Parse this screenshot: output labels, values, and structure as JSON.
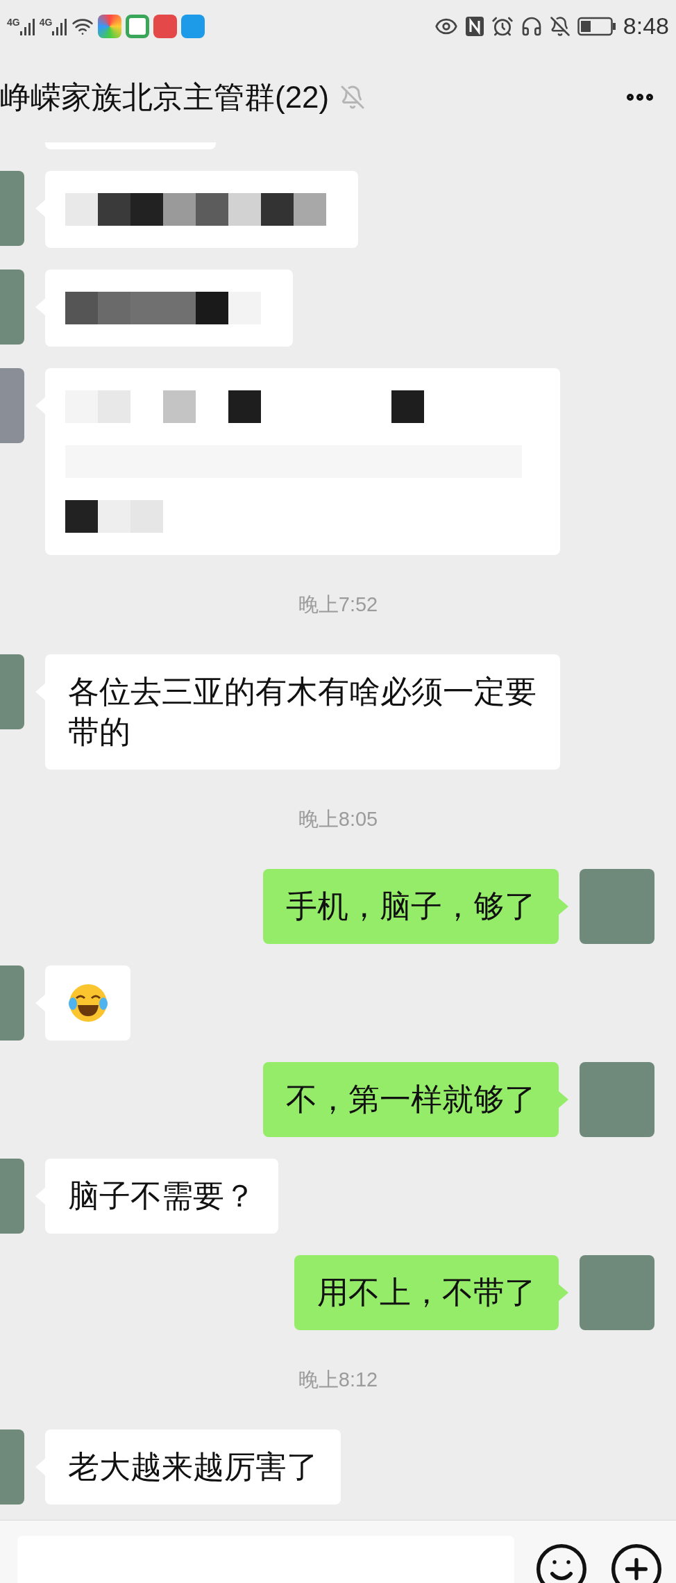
{
  "status_bar": {
    "networks": [
      "4G",
      "4G"
    ],
    "time": "8:48"
  },
  "header": {
    "title": "峥嵘家族北京主管群(22)",
    "muted": true
  },
  "messages": [
    {
      "kind": "cut",
      "outgoing": false
    },
    {
      "kind": "redacted",
      "outgoing": false
    },
    {
      "kind": "redacted",
      "outgoing": false
    },
    {
      "kind": "redacted",
      "outgoing": false
    },
    {
      "kind": "time",
      "text": "晚上7:52"
    },
    {
      "kind": "text",
      "outgoing": false,
      "text": "各位去三亚的有木有啥必须一定要带的"
    },
    {
      "kind": "time",
      "text": "晚上8:05"
    },
    {
      "kind": "text",
      "outgoing": true,
      "text": "手机，脑子，够了"
    },
    {
      "kind": "emoji",
      "outgoing": false
    },
    {
      "kind": "text",
      "outgoing": true,
      "text": "不，第一样就够了"
    },
    {
      "kind": "text",
      "outgoing": false,
      "text": "脑子不需要？"
    },
    {
      "kind": "text",
      "outgoing": true,
      "text": "用不上，不带了"
    },
    {
      "kind": "time",
      "text": "晚上8:12"
    },
    {
      "kind": "text",
      "outgoing": false,
      "text": "老大越来越厉害了"
    }
  ]
}
